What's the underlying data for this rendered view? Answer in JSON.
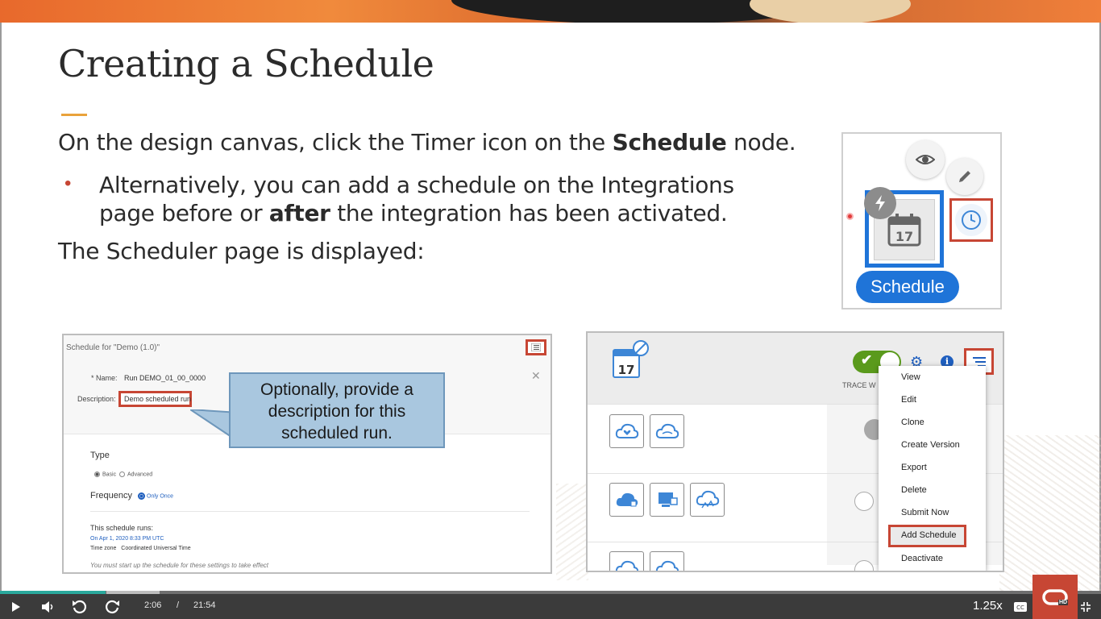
{
  "slide": {
    "title": "Creating a Schedule",
    "line1_pre": "On the design canvas, click the Timer icon on the ",
    "line1_bold": "Schedule",
    "line1_post": " node.",
    "bullet_pre": "Alternatively, you can add a schedule on the Integrations page before or ",
    "bullet_bold": "after",
    "bullet_post": " the integration has been activated.",
    "line3": "The Scheduler page is displayed:"
  },
  "node_figure": {
    "node_label": "Schedule",
    "calendar_day": "17"
  },
  "schedule_form": {
    "title": "Schedule for \"Demo (1.0)\"",
    "name_label": "* Name:",
    "name_value": "Run DEMO_01_00_0000",
    "description_label": "Description:",
    "description_value": "Demo scheduled run",
    "type_label": "Type",
    "type_basic": "Basic",
    "type_advanced": "Advanced",
    "frequency_label": "Frequency",
    "frequency_option": "Only Once",
    "runs_label": "This schedule runs:",
    "runs_date": "On Apr 1, 2020 8:33 PM UTC",
    "timezone_label": "Time zone",
    "timezone_value": "Coordinated Universal Time",
    "note": "You must start up the schedule for these settings to take effect",
    "close_glyph": "✕"
  },
  "callout": {
    "line1": "Optionally, provide a",
    "line2": "description for this",
    "line3": "scheduled run."
  },
  "integrations_panel": {
    "calendar_day": "17",
    "trace_label": "TRACE W",
    "menu_items": [
      "View",
      "Edit",
      "Clone",
      "Create Version",
      "Export",
      "Delete",
      "Submit Now",
      "Add Schedule",
      "Deactivate"
    ]
  },
  "player": {
    "current_time": "2:06",
    "separator": "/",
    "duration": "21:54",
    "speed": "1.25x",
    "hd_badge": "HD",
    "progress_fraction": 0.096
  },
  "colors": {
    "accent_red": "#c74634",
    "oracle_blue": "#1f74d8",
    "progress": "#2aa89c"
  }
}
